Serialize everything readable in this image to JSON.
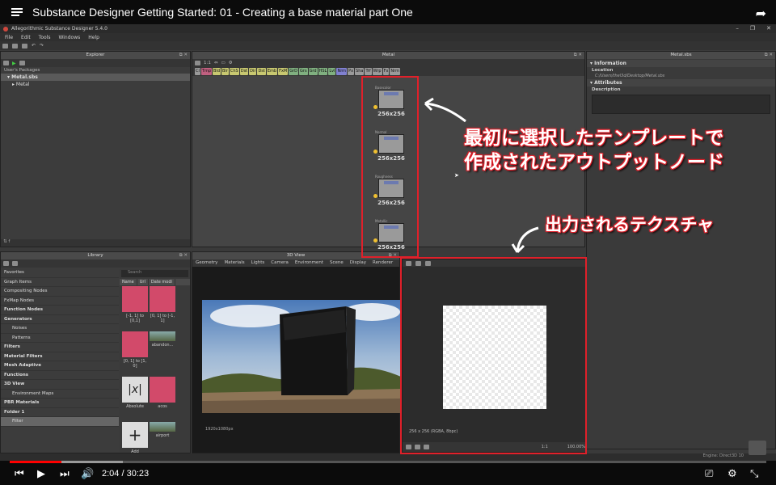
{
  "video": {
    "title": "Substance Designer Getting Started: 01 - Creating a base material part One",
    "time_current": "2:04",
    "time_total": "30:23",
    "progress": 0.068,
    "buffered": 0.15
  },
  "app": {
    "window_title": "Allegorithmic Substance Designer 5.4.0",
    "menu": [
      "File",
      "Edit",
      "Tools",
      "Windows",
      "Help"
    ]
  },
  "explorer": {
    "title": "Explorer",
    "section": "User's Packages",
    "package": "Metal.sbs",
    "graph": "Metal"
  },
  "graph": {
    "title": "Metal",
    "zoom": "1:1",
    "node_buttons": [
      "Cl",
      "Tmp",
      "Bld",
      "Blr",
      "ChS",
      "Dst",
      "Dir",
      "Dst",
      "Emb",
      "FxM",
      "GrD",
      "Grs",
      "Grd",
      "HSL",
      "Lvl",
      "Nrm",
      "Px",
      "Sha",
      "Trf",
      "Wrp",
      "Fx",
      "Nrm"
    ],
    "outputs": [
      {
        "name": "Basecolor",
        "size": "256x256"
      },
      {
        "name": "Normal",
        "size": "256x256"
      },
      {
        "name": "Roughness",
        "size": "256x256"
      },
      {
        "name": "Metallic",
        "size": "256x256"
      }
    ]
  },
  "properties": {
    "title": "Metal.sbs",
    "information_label": "Information",
    "location_label": "Location",
    "location_value": "C:/Users/thel3d/Desktop/Metal.sbs",
    "attributes_label": "Attributes",
    "description_label": "Description"
  },
  "library": {
    "title": "Library",
    "search_placeholder": "Search",
    "columns": [
      "Name",
      "Url",
      "Date modi"
    ],
    "tree": [
      {
        "label": "Favorites",
        "style": "normal"
      },
      {
        "label": "Graph Items",
        "style": "normal"
      },
      {
        "label": "Compositing Nodes",
        "style": "normal"
      },
      {
        "label": "FxMap Nodes",
        "style": "normal"
      },
      {
        "label": "Function Nodes",
        "style": "bold"
      },
      {
        "label": "Generators",
        "style": "bold"
      },
      {
        "label": "Noises",
        "style": "sub"
      },
      {
        "label": "Patterns",
        "style": "sub"
      },
      {
        "label": "Filters",
        "style": "bold"
      },
      {
        "label": "Material Filters",
        "style": "bold"
      },
      {
        "label": "Mesh Adaptive",
        "style": "bold"
      },
      {
        "label": "Functions",
        "style": "bold"
      },
      {
        "label": "3D View",
        "style": "bold"
      },
      {
        "label": "Environment Maps",
        "style": "sub"
      },
      {
        "label": "PBR Materials",
        "style": "bold"
      },
      {
        "label": "Folder 1",
        "style": "bold"
      },
      {
        "label": "Filter",
        "style": "sel"
      }
    ],
    "items": [
      {
        "label": "[-1, 1] to [0,1]"
      },
      {
        "label": "[0, 1] to [-1, 1]"
      },
      {
        "label": "[0, 1] to [1, 0]"
      },
      {
        "label": "abandon..."
      },
      {
        "label": "Absolute"
      },
      {
        "label": "acos"
      },
      {
        "label": "Add"
      },
      {
        "label": "airport"
      }
    ]
  },
  "view3d": {
    "title": "3D View",
    "menu": [
      "Geometry",
      "Materials",
      "Lights",
      "Camera",
      "Environment",
      "Scene",
      "Display",
      "Renderer"
    ],
    "resolution": "1920x1080px"
  },
  "view2d": {
    "info": "256 x 256 (RGBA, 8bpc)",
    "zoom": "100.00%",
    "ratio": "1:1"
  },
  "status": {
    "engine": "Engine: Direct3D 10"
  },
  "annotations": {
    "line1": "最初に選択したテンプレートで",
    "line2": "作成されたアウトプットノード",
    "texture": "出力されるテクスチャ"
  },
  "colors": {
    "annotation_red": "#e0202a",
    "progress_red": "#ff0000"
  }
}
